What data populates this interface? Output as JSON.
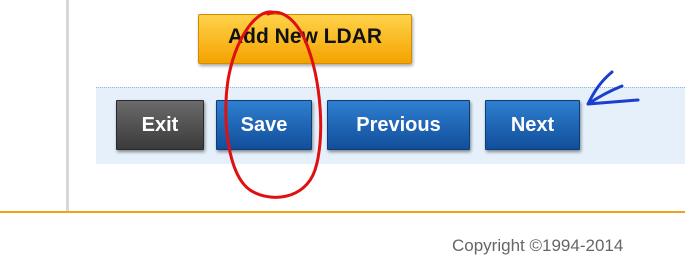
{
  "buttons": {
    "add_new": "Add New LDAR",
    "exit": "Exit",
    "save": "Save",
    "previous": "Previous",
    "next": "Next"
  },
  "footer": {
    "copyright": "Copyright ©1994-2014"
  },
  "colors": {
    "add_button": "#f4a300",
    "exit_button": "#3b3b3b",
    "primary_button": "#114f9b",
    "toolbar_background": "#e6f0fb",
    "footer_rule": "#f0a11c",
    "annotation_red": "#e01010",
    "annotation_blue": "#1a3fd0"
  }
}
